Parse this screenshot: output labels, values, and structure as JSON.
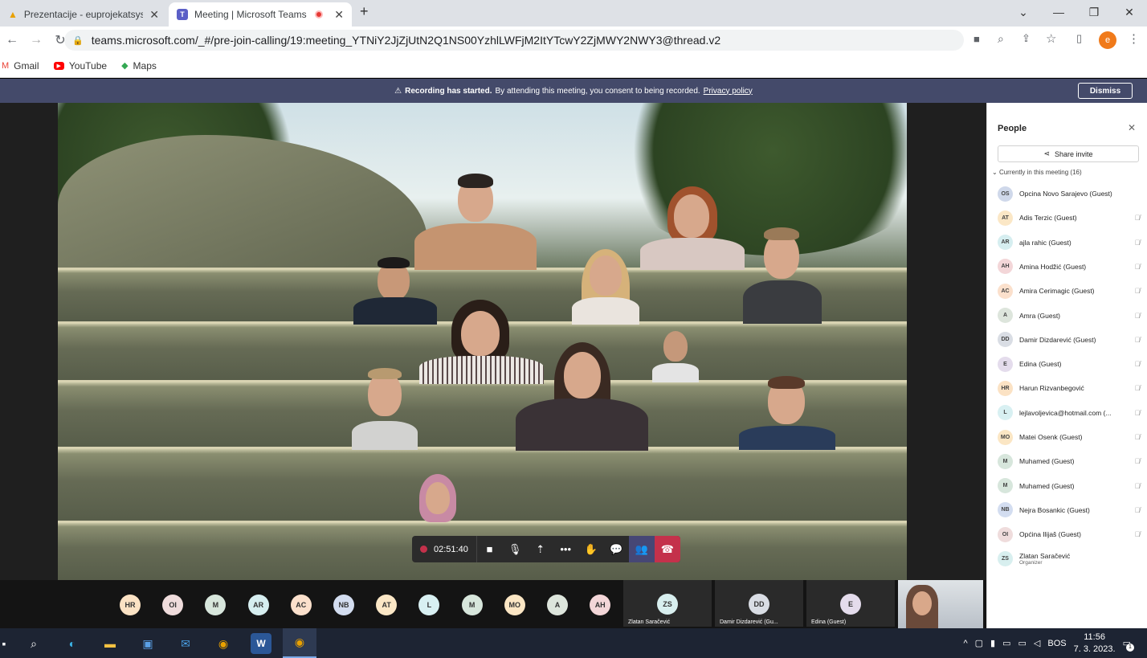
{
  "browser": {
    "tabs": [
      {
        "title": "Prezentacije - euprojekatsystem(",
        "active": false
      },
      {
        "title": "Meeting | Microsoft Teams",
        "active": true
      }
    ],
    "url": "teams.microsoft.com/_#/pre-join-calling/19:meeting_YTNiY2JjZjUtN2Q1NS00YzhlLWFjM2ItYTcwY2ZjMWY2NWY3@thread.v2",
    "profile_initial": "e",
    "bookmarks": [
      "Gmail",
      "YouTube",
      "Maps"
    ]
  },
  "banner": {
    "bold": "Recording has started.",
    "text": "By attending this meeting, you consent to being recorded.",
    "link": "Privacy policy",
    "dismiss": "Dismiss"
  },
  "toolbar": {
    "timer": "02:51:40"
  },
  "panel": {
    "title": "People",
    "share": "Share invite",
    "section": "Currently in this meeting (16)",
    "participants": [
      {
        "initials": "OS",
        "name": "Opcina Novo Sarajevo (Guest)",
        "color": "#cfd8ea",
        "muted": false
      },
      {
        "initials": "AT",
        "name": "Adis Terzic (Guest)",
        "color": "#fbe7c6",
        "muted": true
      },
      {
        "initials": "AR",
        "name": "ajla rahic (Guest)",
        "color": "#d6eef0",
        "muted": true
      },
      {
        "initials": "AH",
        "name": "Amina Hodžić (Guest)",
        "color": "#f3d6d8",
        "muted": true
      },
      {
        "initials": "AC",
        "name": "Amira Cerimagic (Guest)",
        "color": "#fbe0cc",
        "muted": true
      },
      {
        "initials": "A",
        "name": "Amra (Guest)",
        "color": "#dde5dc",
        "muted": true
      },
      {
        "initials": "DD",
        "name": "Damir Dizdarević (Guest)",
        "color": "#d9dde4",
        "muted": true
      },
      {
        "initials": "E",
        "name": "Edina (Guest)",
        "color": "#e4dcec",
        "muted": true
      },
      {
        "initials": "HR",
        "name": "Harun Rizvanbegović",
        "color": "#fbe2c4",
        "muted": true
      },
      {
        "initials": "L",
        "name": "lejlavoljevica@hotmail.com (...",
        "color": "#d8f0f2",
        "muted": true
      },
      {
        "initials": "MO",
        "name": "Matei Osenk (Guest)",
        "color": "#fbe6c4",
        "muted": true
      },
      {
        "initials": "M",
        "name": "Muhamed (Guest)",
        "color": "#d7e6dc",
        "muted": true
      },
      {
        "initials": "M",
        "name": "Muhamed (Guest)",
        "color": "#d7e6dc",
        "muted": true
      },
      {
        "initials": "NB",
        "name": "Nejra Bosankic (Guest)",
        "color": "#d3ddf0",
        "muted": true
      },
      {
        "initials": "OI",
        "name": "Općina Ilijaš (Guest)",
        "color": "#efdcdc",
        "muted": true
      },
      {
        "initials": "ZS",
        "name": "Zlatan Saračević",
        "sub": "Organizer",
        "color": "#d8efef",
        "muted": false
      }
    ]
  },
  "strip": {
    "avatars": [
      {
        "initials": "HR",
        "color": "#fbe2c4"
      },
      {
        "initials": "OI",
        "color": "#efdcdc"
      },
      {
        "initials": "M",
        "color": "#d7e6dc"
      },
      {
        "initials": "AR",
        "color": "#d6eef0"
      },
      {
        "initials": "AC",
        "color": "#fbe0cc"
      },
      {
        "initials": "NB",
        "color": "#d3ddf0"
      },
      {
        "initials": "AT",
        "color": "#fbe7c6"
      },
      {
        "initials": "L",
        "color": "#d8f0f2"
      },
      {
        "initials": "M",
        "color": "#d7e6dc"
      },
      {
        "initials": "MO",
        "color": "#fbe6c4"
      },
      {
        "initials": "A",
        "color": "#dde5dc"
      },
      {
        "initials": "AH",
        "color": "#f3d6d8"
      }
    ],
    "tiles": [
      {
        "initials": "ZS",
        "label": "Zlatan Saračević",
        "color": "#d8efef"
      },
      {
        "initials": "DD",
        "label": "Damir Dizdarević (Gu...",
        "color": "#d9dde4"
      },
      {
        "initials": "E",
        "label": "Edina (Guest)",
        "color": "#e4dcec"
      }
    ]
  },
  "taskbar": {
    "lang": "BOS",
    "time": "11:56",
    "date": "7. 3. 2023.",
    "notifications": "1"
  }
}
